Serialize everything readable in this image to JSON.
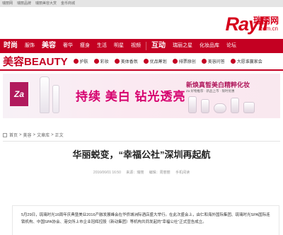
{
  "toplinks": [
    "瑞丽网",
    "瑞丽品牌",
    "瑞丽美容大赏",
    "金币商城"
  ],
  "logo": {
    "text": "Rayli",
    "cn": "瑞丽网",
    "url": ".com.cn"
  },
  "nav": {
    "items": [
      {
        "label": "时尚",
        "big": true
      },
      {
        "label": "服饰"
      },
      {
        "label": "美容",
        "big": true
      },
      {
        "label": "奢华"
      },
      {
        "label": "瘦身"
      },
      {
        "label": "生活"
      },
      {
        "label": "明星"
      },
      {
        "label": "视频"
      },
      {
        "label": "互动",
        "big": true
      },
      {
        "label": "瑞丽之星"
      },
      {
        "label": "化妆品库"
      },
      {
        "label": "论坛"
      }
    ]
  },
  "subnav": {
    "brand": "美容BEAUTY",
    "items": [
      "护肤",
      "彩妆",
      "美体香氛",
      "优品筹划",
      "排票原创",
      "美容问答",
      "大愿谁赢家会"
    ]
  },
  "ad": {
    "brand_mark": "Za",
    "slogan": "持续 美白 钻光透亮",
    "new_text": "新焕真皙美白精粹化妆",
    "small_text": "Za 好物推荐 · 新品上市 · 限时优惠"
  },
  "breadcrumb": [
    "首页",
    "美容",
    "文章库",
    "正文"
  ],
  "article": {
    "title": "华丽蜕变，“幸福公社”深圳再起航",
    "date": "2016/06/01 16:50",
    "source_label": "来源：瑞丽",
    "editor": "编辑：周丽丽",
    "mobile": "手机阅读",
    "body": "5月29日，琉璃时光16周年庆典暨美业2016产融发展峰会在华侨城洲际酒店盛大举行。在此次盛会上，由仁和海外国际集团、琉璃时光SPA国际连锁机构、中国SPA协会、港交所上市企业冠辉控股（新动集团）等机构共同发起的“幸福公社”正式宣告成立。"
  },
  "colors": {
    "brand_red": "#c40022",
    "accent_pink": "#d6006e"
  }
}
